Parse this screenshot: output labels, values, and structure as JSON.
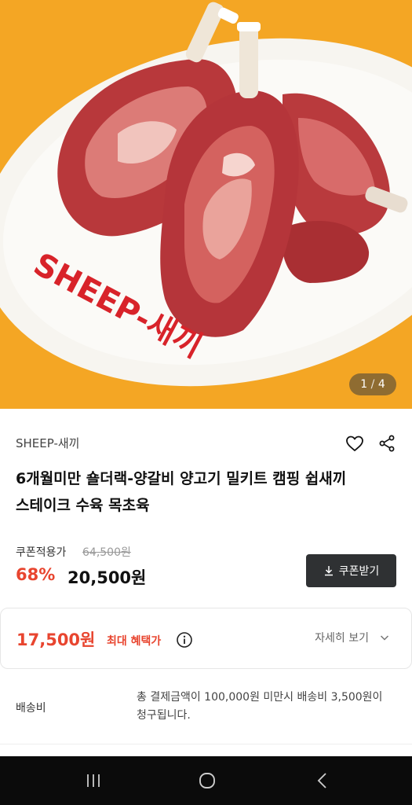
{
  "hero": {
    "pager_current": "1",
    "pager_sep": "/",
    "pager_total": "4",
    "plate_text": "SHEEP-새끼"
  },
  "product": {
    "brand": "SHEEP-새끼",
    "title_line1": "6개월미만 숄더랙-양갈비 양고기 밀키트 캠핑 쉽새끼",
    "title_line2": "스테이크 수육 목초육",
    "coupon_label": "쿠폰적용가",
    "original_price": "64,500원",
    "discount": "68%",
    "price": "20,500원",
    "coupon_button": "쿠폰받기"
  },
  "benefit": {
    "price": "17,500원",
    "label": "최대 혜택가",
    "detail": "자세히 보기"
  },
  "shipping": {
    "label": "배송비",
    "text": "총 결제금액이 100,000원 미만시 배송비 3,500원이 청구됩니다."
  },
  "colors": {
    "accent": "#e8452f",
    "hero_bg": "#f4a624",
    "button_bg": "#2f3133"
  },
  "icons": [
    "heart-icon",
    "share-icon",
    "download-icon",
    "info-icon",
    "chevron-down-icon",
    "recents-icon",
    "home-icon",
    "back-icon"
  ]
}
